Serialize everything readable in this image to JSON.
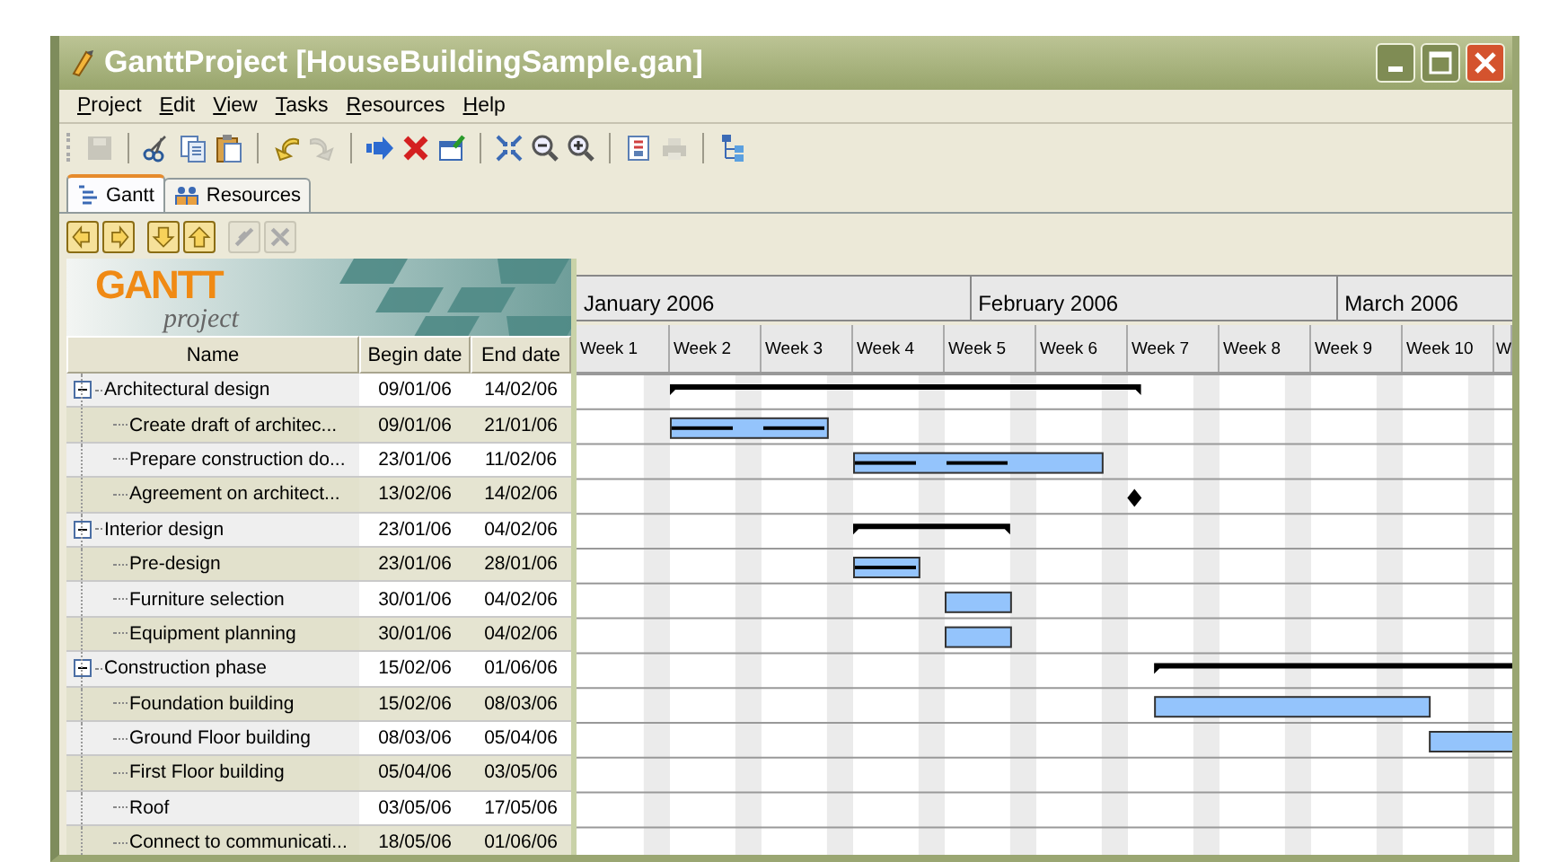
{
  "window": {
    "title": "GanttProject [HouseBuildingSample.gan]"
  },
  "menu": [
    "Project",
    "Edit",
    "View",
    "Tasks",
    "Resources",
    "Help"
  ],
  "toolbar": [
    {
      "kind": "save",
      "disabled": true
    },
    {
      "kind": "separator"
    },
    {
      "kind": "cut",
      "disabled": false
    },
    {
      "kind": "copy",
      "disabled": false
    },
    {
      "kind": "paste",
      "disabled": false
    },
    {
      "kind": "separator"
    },
    {
      "kind": "undo",
      "disabled": false
    },
    {
      "kind": "redo",
      "disabled": true
    },
    {
      "kind": "separator"
    },
    {
      "kind": "indent",
      "disabled": false
    },
    {
      "kind": "delete",
      "disabled": false
    },
    {
      "kind": "properties",
      "disabled": false
    },
    {
      "kind": "separator"
    },
    {
      "kind": "fit",
      "disabled": false
    },
    {
      "kind": "zoom-out",
      "disabled": false
    },
    {
      "kind": "zoom-in",
      "disabled": false
    },
    {
      "kind": "separator"
    },
    {
      "kind": "preview",
      "disabled": false
    },
    {
      "kind": "print",
      "disabled": true
    },
    {
      "kind": "separator"
    },
    {
      "kind": "resource",
      "disabled": false
    }
  ],
  "tabs": [
    {
      "label": "Gantt",
      "selected": true
    },
    {
      "label": "Resources",
      "selected": false
    }
  ],
  "nav_buttons": [
    {
      "kind": "left",
      "disabled": false
    },
    {
      "kind": "right",
      "disabled": false
    },
    {
      "kind": "down",
      "disabled": false
    },
    {
      "kind": "up",
      "disabled": false
    },
    {
      "kind": "link",
      "disabled": true
    },
    {
      "kind": "unlink",
      "disabled": true
    }
  ],
  "logo": {
    "title": "GANTT",
    "subtitle": "project"
  },
  "table": {
    "columns": [
      "Name",
      "Begin date",
      "End date"
    ]
  },
  "timeline": {
    "months": [
      "January 2006",
      "February 2006",
      "March 2006"
    ],
    "weeks": [
      "Week 1",
      "Week 2",
      "Week 3",
      "Week 4",
      "Week 5",
      "Week 6",
      "Week 7",
      "Week 8",
      "Week 9",
      "Week 10",
      "W"
    ]
  },
  "tasks": [
    {
      "name": "Architectural design",
      "begin": "09/01/06",
      "end": "14/02/06",
      "kind": "summary",
      "expanded": true,
      "children": [
        {
          "name": "Create draft of architec...",
          "begin": "09/01/06",
          "end": "21/01/06",
          "kind": "task",
          "level": 1
        },
        {
          "name": "Prepare construction do...",
          "begin": "23/01/06",
          "end": "11/02/06",
          "kind": "task",
          "level": 0.62
        },
        {
          "name": "Agreement on architect...",
          "begin": "13/02/06",
          "end": "14/02/06",
          "kind": "milestone"
        }
      ]
    },
    {
      "name": "Interior design",
      "begin": "23/01/06",
      "end": "04/02/06",
      "kind": "summary",
      "expanded": true,
      "children": [
        {
          "name": "Pre-design",
          "begin": "23/01/06",
          "end": "28/01/06",
          "kind": "task",
          "level": 1
        },
        {
          "name": "Furniture selection",
          "begin": "30/01/06",
          "end": "04/02/06",
          "kind": "task"
        },
        {
          "name": "Equipment planning",
          "begin": "30/01/06",
          "end": "04/02/06",
          "kind": "task"
        }
      ]
    },
    {
      "name": "Construction phase",
      "begin": "15/02/06",
      "end": "01/06/06",
      "kind": "summary",
      "expanded": true,
      "children": [
        {
          "name": "Foundation building",
          "begin": "15/02/06",
          "end": "08/03/06",
          "kind": "task"
        },
        {
          "name": "Ground Floor building",
          "begin": "08/03/06",
          "end": "05/04/06",
          "kind": "task"
        },
        {
          "name": "First Floor building",
          "begin": "05/04/06",
          "end": "03/05/06",
          "kind": "task"
        },
        {
          "name": "Roof",
          "begin": "03/05/06",
          "end": "17/05/06",
          "kind": "task"
        },
        {
          "name": "Connect to communicati...",
          "begin": "18/05/06",
          "end": "01/06/06",
          "kind": "task"
        }
      ]
    }
  ]
}
